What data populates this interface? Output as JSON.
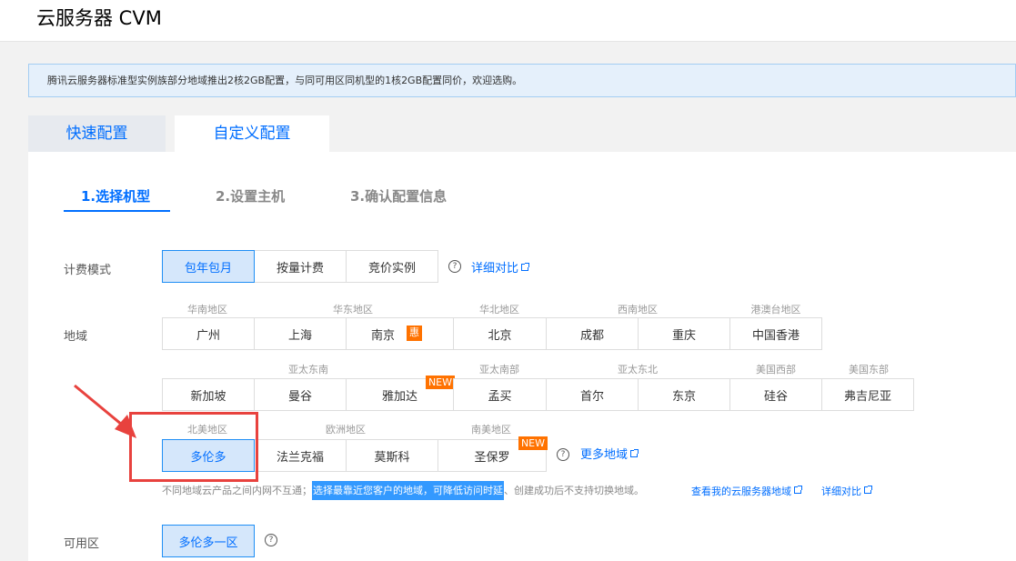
{
  "header": {
    "title": "云服务器 CVM"
  },
  "notice": {
    "text": "腾讯云服务器标准型实例族部分地域推出2核2GB配置，与同可用区同机型的1核2GB配置同价，欢迎选购。"
  },
  "mode_tabs": [
    "快速配置",
    "自定义配置"
  ],
  "steps": [
    "1.选择机型",
    "2.设置主机",
    "3.确认配置信息"
  ],
  "billing": {
    "label": "计费模式",
    "options": [
      "包年包月",
      "按量计费",
      "竞价实例"
    ],
    "compare_link": "详细对比"
  },
  "region": {
    "label": "地域",
    "row1_groups": [
      "华南地区",
      "华东地区",
      "华北地区",
      "西南地区",
      "港澳台地区"
    ],
    "row1": [
      "广州",
      "上海",
      "南京",
      "北京",
      "成都",
      "重庆",
      "中国香港"
    ],
    "hui_tag": "惠",
    "row2_groups": [
      "亚太东南",
      "亚太南部",
      "亚太东北",
      "美国西部",
      "美国东部"
    ],
    "row2": [
      "新加坡",
      "曼谷",
      "雅加达",
      "孟买",
      "首尔",
      "东京",
      "硅谷",
      "弗吉尼亚"
    ],
    "row3_groups": [
      "北美地区",
      "欧洲地区",
      "南美地区"
    ],
    "row3": [
      "多伦多",
      "法兰克福",
      "莫斯科",
      "圣保罗"
    ],
    "new_tag": "NEW",
    "more_link": "更多地域",
    "hint_prefix": "不同地域云产品之间内网不互通；",
    "hint_highlight": "选择最靠近您客户的地域，可降低访问时延",
    "hint_suffix": "、创建成功后不支持切换地域。",
    "view_link": "查看我的云服务器地域",
    "compare_link": "详细对比"
  },
  "zone": {
    "label": "可用区",
    "selected": "多伦多一区"
  },
  "colors": {
    "accent": "#006eff",
    "selected_bg": "#d5e7fb",
    "tag": "#ff7200",
    "annotation": "#e8423e"
  },
  "icons": [
    "help-icon",
    "external-link-icon",
    "annotation-arrow"
  ]
}
